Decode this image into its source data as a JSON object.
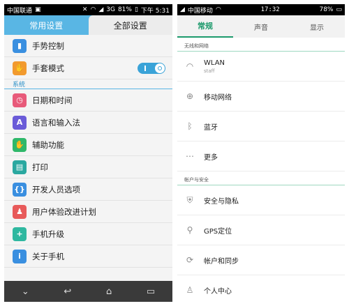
{
  "left_phone": {
    "status_bar": {
      "carrier": "中国联通",
      "signal": "3G",
      "battery": "81%",
      "time": "下午 5:31"
    },
    "tabs": [
      {
        "label": "常用设置"
      },
      {
        "label": "全部设置"
      }
    ],
    "top_items": [
      {
        "label": "手势控制",
        "icon": "gesture-icon",
        "color": "#3a8fe0"
      },
      {
        "label": "手套模式",
        "icon": "glove-icon",
        "color": "#f29a2e"
      }
    ],
    "section_label": "系统",
    "system_items": [
      {
        "label": "日期和时间",
        "icon": "clock-icon",
        "color": "#e85a7a"
      },
      {
        "label": "语言和输入法",
        "icon": "language-icon",
        "color": "#6a5bd8"
      },
      {
        "label": "辅助功能",
        "icon": "hand-icon",
        "color": "#2fb86a"
      },
      {
        "label": "打印",
        "icon": "printer-icon",
        "color": "#2aa8a0"
      },
      {
        "label": "开发人员选项",
        "icon": "developer-icon",
        "color": "#3a8fe0"
      },
      {
        "label": "用户体验改进计划",
        "icon": "user-plan-icon",
        "color": "#e85a5a"
      },
      {
        "label": "手机升级",
        "icon": "upgrade-icon",
        "color": "#2fb8a0"
      },
      {
        "label": "关于手机",
        "icon": "info-icon",
        "color": "#3a8fe0"
      }
    ],
    "glove_mode_on": true
  },
  "right_phone": {
    "status_bar": {
      "carrier": "中国移动",
      "time": "17:32",
      "battery": "78%"
    },
    "tabs": [
      {
        "label": "常规"
      },
      {
        "label": "声音"
      },
      {
        "label": "显示"
      }
    ],
    "section_network": "无线和网络",
    "network_items": [
      {
        "label": "WLAN",
        "sub": "staff",
        "icon": "wifi-icon"
      },
      {
        "label": "移动网络",
        "sub": "",
        "icon": "globe-icon"
      },
      {
        "label": "蓝牙",
        "sub": "",
        "icon": "bluetooth-icon"
      },
      {
        "label": "更多",
        "sub": "",
        "icon": "more-icon"
      }
    ],
    "section_account": "帐户与安全",
    "account_items": [
      {
        "label": "安全与隐私",
        "icon": "shield-icon"
      },
      {
        "label": "GPS定位",
        "icon": "location-icon"
      },
      {
        "label": "帐户和同步",
        "icon": "sync-icon"
      },
      {
        "label": "个人中心",
        "icon": "person-icon"
      }
    ]
  }
}
